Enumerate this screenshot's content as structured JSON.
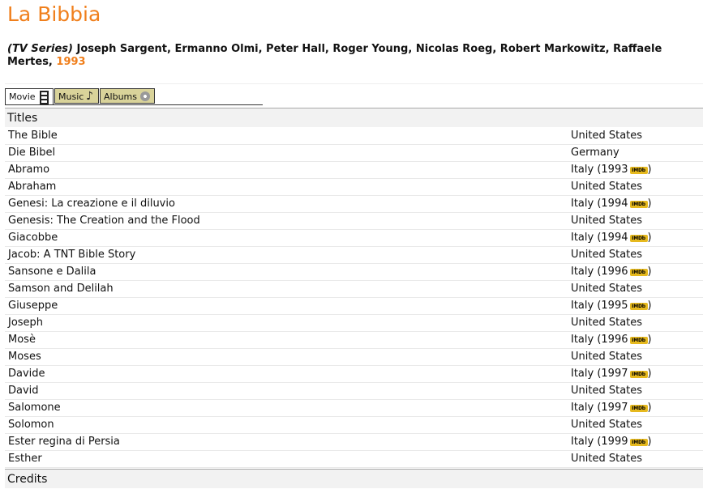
{
  "header": {
    "title": "La Bibbia",
    "series_label": "(TV Series)",
    "directors": " Joseph Sargent, Ermanno Olmi, Peter Hall, Roger Young, Nicolas Roeg, Robert Markowitz, Raffaele Mertes, ",
    "year": "1993"
  },
  "tabs": [
    {
      "label": "Movie",
      "icon": "film-icon",
      "active": true
    },
    {
      "label": "Music",
      "icon": "music-note-icon",
      "active": false
    },
    {
      "label": "Albums",
      "icon": "disc-icon",
      "active": false
    }
  ],
  "sections": {
    "titles_header": "Titles",
    "credits_header": "Credits"
  },
  "imdb_badge": "IMDb",
  "titles": [
    {
      "title": "The Bible",
      "country": "United States",
      "imdb": false
    },
    {
      "title": "Die Bibel",
      "country": "Germany",
      "imdb": false
    },
    {
      "title": "Abramo",
      "country": "Italy (1993",
      "imdb": true
    },
    {
      "title": "Abraham",
      "country": "United States",
      "imdb": false
    },
    {
      "title": "Genesi: La creazione e il diluvio",
      "country": "Italy (1994",
      "imdb": true
    },
    {
      "title": "Genesis: The Creation and the Flood",
      "country": "United States",
      "imdb": false
    },
    {
      "title": "Giacobbe",
      "country": "Italy (1994",
      "imdb": true
    },
    {
      "title": "Jacob: A TNT Bible Story",
      "country": "United States",
      "imdb": false
    },
    {
      "title": "Sansone e Dalila",
      "country": "Italy (1996",
      "imdb": true
    },
    {
      "title": "Samson and Delilah",
      "country": "United States",
      "imdb": false
    },
    {
      "title": "Giuseppe",
      "country": "Italy (1995",
      "imdb": true
    },
    {
      "title": "Joseph",
      "country": "United States",
      "imdb": false
    },
    {
      "title": "Mosè",
      "country": "Italy (1996",
      "imdb": true
    },
    {
      "title": "Moses",
      "country": "United States",
      "imdb": false
    },
    {
      "title": "Davide",
      "country": "Italy (1997",
      "imdb": true
    },
    {
      "title": "David",
      "country": "United States",
      "imdb": false
    },
    {
      "title": "Salomone",
      "country": "Italy (1997",
      "imdb": true
    },
    {
      "title": "Solomon",
      "country": "United States",
      "imdb": false
    },
    {
      "title": "Ester regina di Persia",
      "country": "Italy (1999",
      "imdb": true
    },
    {
      "title": "Esther",
      "country": "United States",
      "imdb": false
    }
  ],
  "colors": {
    "accent": "#f07f1c",
    "tab_inactive": "#d9d39a",
    "imdb": "#e6b91e"
  }
}
